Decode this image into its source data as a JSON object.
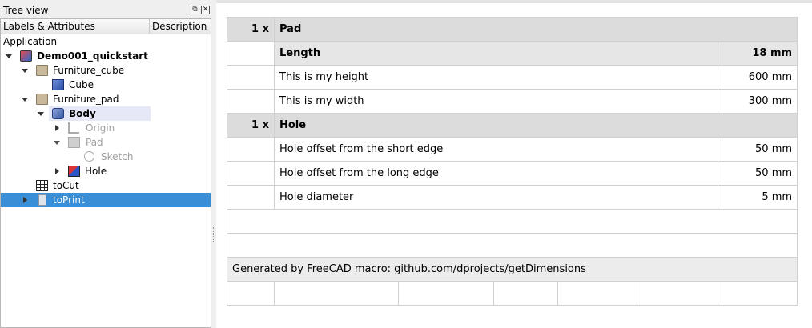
{
  "tree": {
    "title": "Tree view",
    "title_buttons": [
      "⧉",
      "✕"
    ],
    "columns": [
      "Labels & Attributes",
      "Description"
    ],
    "root_label": "Application",
    "items": [
      {
        "label": "Demo001_quickstart"
      },
      {
        "label": "Furniture_cube"
      },
      {
        "label": "Cube"
      },
      {
        "label": "Furniture_pad"
      },
      {
        "label": "Body"
      },
      {
        "label": "Origin"
      },
      {
        "label": "Pad"
      },
      {
        "label": "Sketch"
      },
      {
        "label": "Hole"
      },
      {
        "label": "toCut"
      },
      {
        "label": "toPrint"
      }
    ]
  },
  "sheet": {
    "sections": [
      {
        "qty": "1 x",
        "name": "Pad",
        "header": {
          "label": "Length",
          "value": "18 mm"
        },
        "rows": [
          {
            "label": "This is my height",
            "value": "600 mm"
          },
          {
            "label": "This is my width",
            "value": "300 mm"
          }
        ]
      },
      {
        "qty": "1 x",
        "name": "Hole",
        "rows": [
          {
            "label": "Hole offset from the short edge",
            "value": "50 mm"
          },
          {
            "label": "Hole offset from the long edge",
            "value": "50 mm"
          },
          {
            "label": "Hole diameter",
            "value": "5 mm"
          }
        ]
      }
    ],
    "footer": "Generated by FreeCAD macro: github.com/dprojects/getDimensions"
  }
}
